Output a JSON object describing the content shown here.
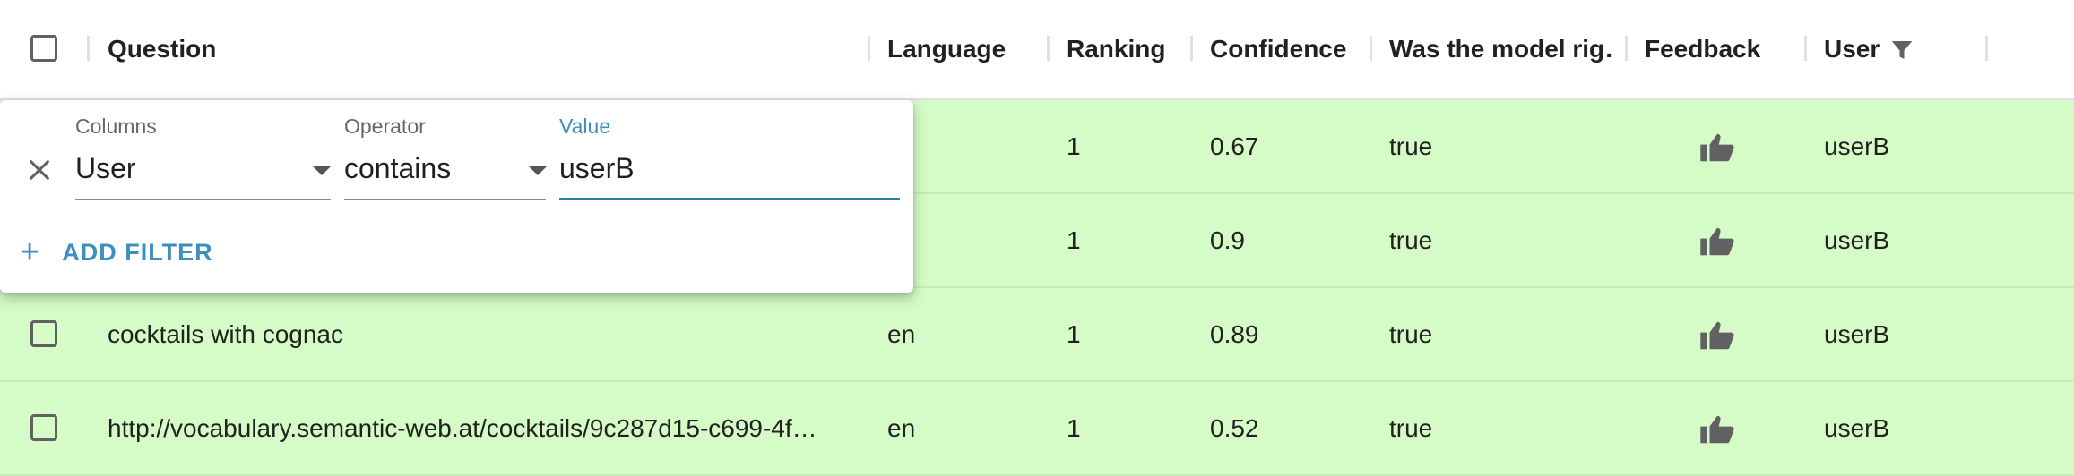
{
  "header": {
    "question": "Question",
    "language": "Language",
    "ranking": "Ranking",
    "confidence": "Confidence",
    "model_right": "Was the model rig…",
    "feedback": "Feedback",
    "user": "User"
  },
  "rows": [
    {
      "question": "",
      "language": "",
      "ranking": "1",
      "confidence": "0.67",
      "model_right": "true",
      "user": "userB"
    },
    {
      "question": "",
      "language": "",
      "ranking": "1",
      "confidence": "0.9",
      "model_right": "true",
      "user": "userB"
    },
    {
      "question": "cocktails with cognac",
      "language": "en",
      "ranking": "1",
      "confidence": "0.89",
      "model_right": "true",
      "user": "userB"
    },
    {
      "question": "http://vocabulary.semantic-web.at/cocktails/9c287d15-c699-4f…",
      "language": "en",
      "ranking": "1",
      "confidence": "0.52",
      "model_right": "true",
      "user": "userB"
    }
  ],
  "filter": {
    "columns_label": "Columns",
    "columns_value": "User",
    "operator_label": "Operator",
    "operator_value": "contains",
    "value_label": "Value",
    "value_value": "userB",
    "add_filter_label": "ADD FILTER"
  },
  "colors": {
    "row_bg": "#d5fcc6",
    "accent": "#3c8fbf",
    "icon": "#616161"
  },
  "icons": [
    "filter-icon",
    "thumb-up-icon",
    "close-icon",
    "plus-icon",
    "chevron-down-icon"
  ]
}
